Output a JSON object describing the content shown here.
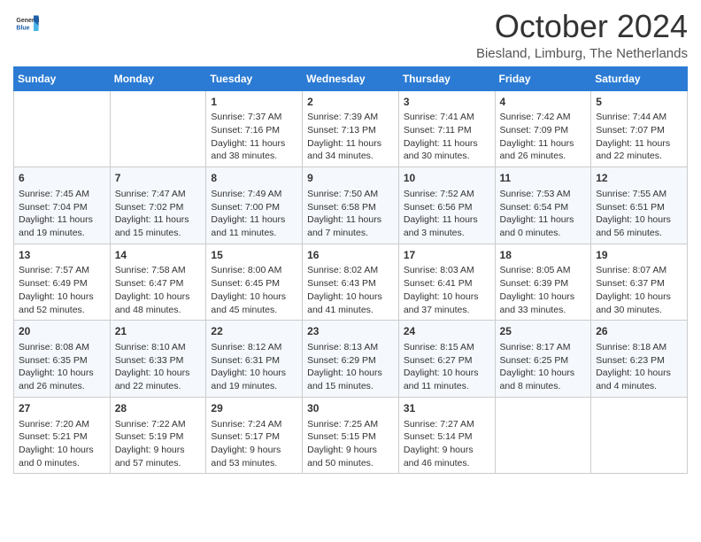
{
  "header": {
    "logo_general": "General",
    "logo_blue": "Blue",
    "month_title": "October 2024",
    "location": "Biesland, Limburg, The Netherlands"
  },
  "weekdays": [
    "Sunday",
    "Monday",
    "Tuesday",
    "Wednesday",
    "Thursday",
    "Friday",
    "Saturday"
  ],
  "weeks": [
    [
      {
        "day": "",
        "info": ""
      },
      {
        "day": "",
        "info": ""
      },
      {
        "day": "1",
        "info": "Sunrise: 7:37 AM\nSunset: 7:16 PM\nDaylight: 11 hours and 38 minutes."
      },
      {
        "day": "2",
        "info": "Sunrise: 7:39 AM\nSunset: 7:13 PM\nDaylight: 11 hours and 34 minutes."
      },
      {
        "day": "3",
        "info": "Sunrise: 7:41 AM\nSunset: 7:11 PM\nDaylight: 11 hours and 30 minutes."
      },
      {
        "day": "4",
        "info": "Sunrise: 7:42 AM\nSunset: 7:09 PM\nDaylight: 11 hours and 26 minutes."
      },
      {
        "day": "5",
        "info": "Sunrise: 7:44 AM\nSunset: 7:07 PM\nDaylight: 11 hours and 22 minutes."
      }
    ],
    [
      {
        "day": "6",
        "info": "Sunrise: 7:45 AM\nSunset: 7:04 PM\nDaylight: 11 hours and 19 minutes."
      },
      {
        "day": "7",
        "info": "Sunrise: 7:47 AM\nSunset: 7:02 PM\nDaylight: 11 hours and 15 minutes."
      },
      {
        "day": "8",
        "info": "Sunrise: 7:49 AM\nSunset: 7:00 PM\nDaylight: 11 hours and 11 minutes."
      },
      {
        "day": "9",
        "info": "Sunrise: 7:50 AM\nSunset: 6:58 PM\nDaylight: 11 hours and 7 minutes."
      },
      {
        "day": "10",
        "info": "Sunrise: 7:52 AM\nSunset: 6:56 PM\nDaylight: 11 hours and 3 minutes."
      },
      {
        "day": "11",
        "info": "Sunrise: 7:53 AM\nSunset: 6:54 PM\nDaylight: 11 hours and 0 minutes."
      },
      {
        "day": "12",
        "info": "Sunrise: 7:55 AM\nSunset: 6:51 PM\nDaylight: 10 hours and 56 minutes."
      }
    ],
    [
      {
        "day": "13",
        "info": "Sunrise: 7:57 AM\nSunset: 6:49 PM\nDaylight: 10 hours and 52 minutes."
      },
      {
        "day": "14",
        "info": "Sunrise: 7:58 AM\nSunset: 6:47 PM\nDaylight: 10 hours and 48 minutes."
      },
      {
        "day": "15",
        "info": "Sunrise: 8:00 AM\nSunset: 6:45 PM\nDaylight: 10 hours and 45 minutes."
      },
      {
        "day": "16",
        "info": "Sunrise: 8:02 AM\nSunset: 6:43 PM\nDaylight: 10 hours and 41 minutes."
      },
      {
        "day": "17",
        "info": "Sunrise: 8:03 AM\nSunset: 6:41 PM\nDaylight: 10 hours and 37 minutes."
      },
      {
        "day": "18",
        "info": "Sunrise: 8:05 AM\nSunset: 6:39 PM\nDaylight: 10 hours and 33 minutes."
      },
      {
        "day": "19",
        "info": "Sunrise: 8:07 AM\nSunset: 6:37 PM\nDaylight: 10 hours and 30 minutes."
      }
    ],
    [
      {
        "day": "20",
        "info": "Sunrise: 8:08 AM\nSunset: 6:35 PM\nDaylight: 10 hours and 26 minutes."
      },
      {
        "day": "21",
        "info": "Sunrise: 8:10 AM\nSunset: 6:33 PM\nDaylight: 10 hours and 22 minutes."
      },
      {
        "day": "22",
        "info": "Sunrise: 8:12 AM\nSunset: 6:31 PM\nDaylight: 10 hours and 19 minutes."
      },
      {
        "day": "23",
        "info": "Sunrise: 8:13 AM\nSunset: 6:29 PM\nDaylight: 10 hours and 15 minutes."
      },
      {
        "day": "24",
        "info": "Sunrise: 8:15 AM\nSunset: 6:27 PM\nDaylight: 10 hours and 11 minutes."
      },
      {
        "day": "25",
        "info": "Sunrise: 8:17 AM\nSunset: 6:25 PM\nDaylight: 10 hours and 8 minutes."
      },
      {
        "day": "26",
        "info": "Sunrise: 8:18 AM\nSunset: 6:23 PM\nDaylight: 10 hours and 4 minutes."
      }
    ],
    [
      {
        "day": "27",
        "info": "Sunrise: 7:20 AM\nSunset: 5:21 PM\nDaylight: 10 hours and 0 minutes."
      },
      {
        "day": "28",
        "info": "Sunrise: 7:22 AM\nSunset: 5:19 PM\nDaylight: 9 hours and 57 minutes."
      },
      {
        "day": "29",
        "info": "Sunrise: 7:24 AM\nSunset: 5:17 PM\nDaylight: 9 hours and 53 minutes."
      },
      {
        "day": "30",
        "info": "Sunrise: 7:25 AM\nSunset: 5:15 PM\nDaylight: 9 hours and 50 minutes."
      },
      {
        "day": "31",
        "info": "Sunrise: 7:27 AM\nSunset: 5:14 PM\nDaylight: 9 hours and 46 minutes."
      },
      {
        "day": "",
        "info": ""
      },
      {
        "day": "",
        "info": ""
      }
    ]
  ]
}
